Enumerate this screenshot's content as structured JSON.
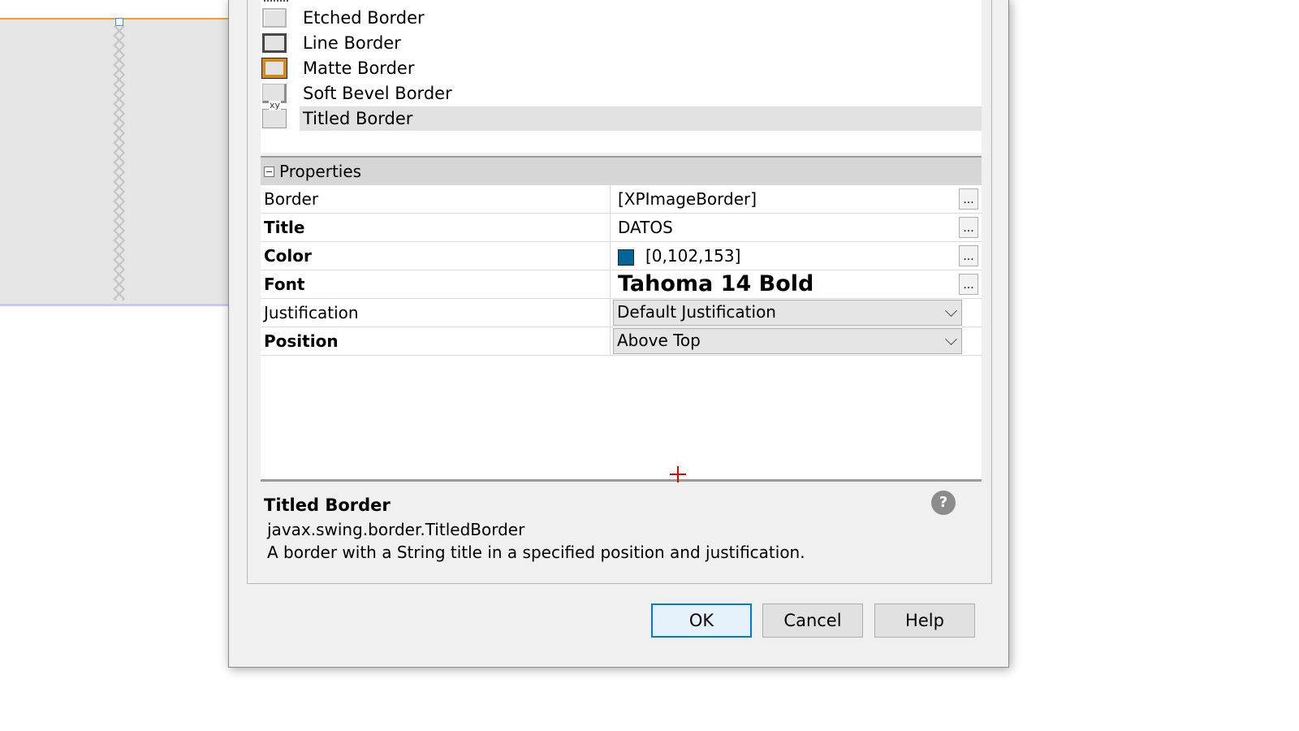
{
  "border_list": {
    "items": [
      {
        "label": "Etched Border",
        "icon": "etched-border-icon"
      },
      {
        "label": "Line Border",
        "icon": "line-border-icon"
      },
      {
        "label": "Matte Border",
        "icon": "matte-border-icon"
      },
      {
        "label": "Soft Bevel Border",
        "icon": "soft-bevel-border-icon"
      },
      {
        "label": "Titled Border",
        "icon": "titled-border-icon",
        "selected": true
      }
    ]
  },
  "properties": {
    "header": "Properties",
    "rows": [
      {
        "name": "Border",
        "value": "[XPImageBorder]"
      },
      {
        "name": "Title",
        "value": "DATOS"
      },
      {
        "name": "Color",
        "value": "[0,102,153]",
        "swatch": "#006699"
      },
      {
        "name": "Font",
        "value": "Tahoma 14 Bold"
      },
      {
        "name": "Justification",
        "value": "Default Justification"
      },
      {
        "name": "Position",
        "value": "Above Top"
      }
    ],
    "dots": "..."
  },
  "description": {
    "title": "Titled Border",
    "class": "javax.swing.border.TitledBorder",
    "text": "A border with a String title in a specified position and justification.",
    "help_icon": "?"
  },
  "buttons": {
    "ok": "OK",
    "cancel": "Cancel",
    "help": "Help"
  },
  "colors": {
    "title_color": "#006699",
    "ok_focus": "#0078d7",
    "cursor": "#e00000"
  }
}
